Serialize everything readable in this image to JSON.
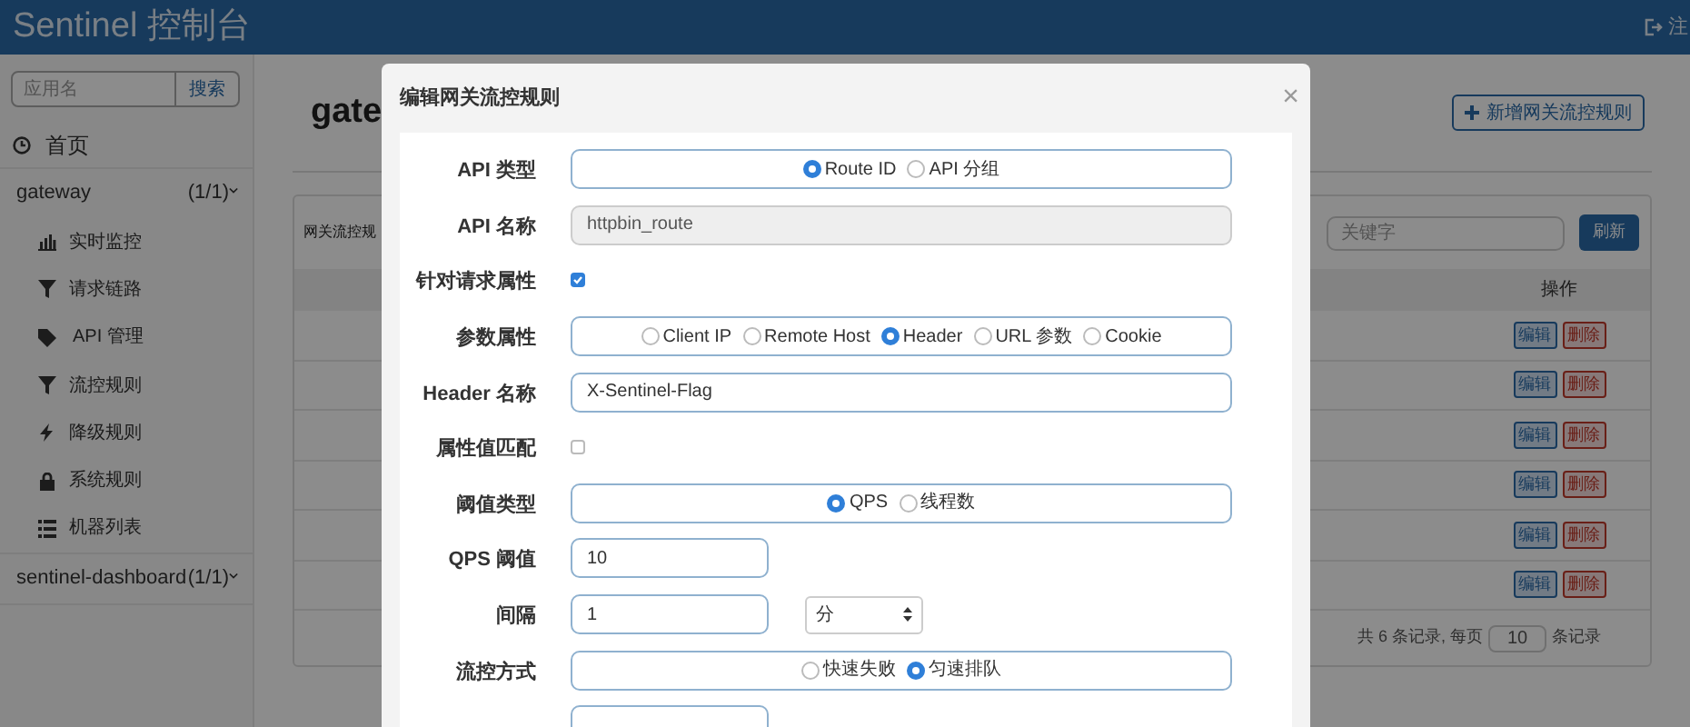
{
  "header": {
    "title": "Sentinel 控制台",
    "logout": "注"
  },
  "sidebar": {
    "search": {
      "placeholder": "应用名",
      "button": "搜索"
    },
    "home": "首页",
    "apps": [
      {
        "name": "gateway",
        "count": "(1/1)",
        "items": [
          {
            "label": "实时监控",
            "kind": "chart"
          },
          {
            "label": "请求链路",
            "kind": "filter"
          },
          {
            "label": "API 管理",
            "kind": "tags"
          },
          {
            "label": "流控规则",
            "kind": "filter"
          },
          {
            "label": "降级规则",
            "kind": "bolt"
          },
          {
            "label": "系统规则",
            "kind": "lock"
          },
          {
            "label": "机器列表",
            "kind": "list"
          }
        ]
      },
      {
        "name": "sentinel-dashboard",
        "count": "(1/1)"
      }
    ]
  },
  "main": {
    "title": "gate",
    "add_button": "新增网关流控规则",
    "panel": {
      "caption": "网关流控规",
      "search_placeholder": "关键字",
      "refresh": "刷新",
      "action_header": "操作",
      "rows": [
        {
          "edit": "编辑",
          "delete": "删除"
        },
        {
          "edit": "编辑",
          "delete": "删除"
        },
        {
          "edit": "编辑",
          "delete": "删除"
        },
        {
          "edit": "编辑",
          "delete": "删除"
        },
        {
          "edit": "编辑",
          "delete": "删除"
        },
        {
          "edit": "编辑",
          "delete": "删除"
        }
      ],
      "footer": {
        "prefix": "共 6 条记录, 每页",
        "page_size": "10",
        "suffix": "条记录"
      }
    }
  },
  "modal": {
    "title": "编辑网关流控规则",
    "close": "×",
    "fields": [
      {
        "kind": "radio",
        "label": "API 类型",
        "options": [
          {
            "label": "Route ID",
            "selected": true
          },
          {
            "label": "API 分组",
            "selected": false
          }
        ]
      },
      {
        "kind": "text",
        "label": "API 名称",
        "value": "httpbin_route",
        "disabled": true
      },
      {
        "kind": "checkbox",
        "label": "针对请求属性",
        "checked": true
      },
      {
        "kind": "radio",
        "label": "参数属性",
        "options": [
          {
            "label": "Client IP",
            "selected": false
          },
          {
            "label": "Remote Host",
            "selected": false
          },
          {
            "label": "Header",
            "selected": true
          },
          {
            "label": "URL 参数",
            "selected": false
          },
          {
            "label": "Cookie",
            "selected": false
          }
        ]
      },
      {
        "kind": "text",
        "label": "Header 名称",
        "value": "X-Sentinel-Flag",
        "disabled": false
      },
      {
        "kind": "checkbox",
        "label": "属性值匹配",
        "checked": false
      },
      {
        "kind": "radio",
        "label": "阈值类型",
        "options": [
          {
            "label": "QPS",
            "selected": true
          },
          {
            "label": "线程数",
            "selected": false
          }
        ]
      },
      {
        "kind": "short",
        "label": "QPS 阈值",
        "value": "10"
      },
      {
        "kind": "interval",
        "label": "间隔",
        "value": "1",
        "unit": "分"
      },
      {
        "kind": "radio",
        "label": "流控方式",
        "options": [
          {
            "label": "快速失败",
            "selected": false
          },
          {
            "label": "匀速排队",
            "selected": true
          }
        ]
      },
      {
        "kind": "short"
      }
    ]
  }
}
